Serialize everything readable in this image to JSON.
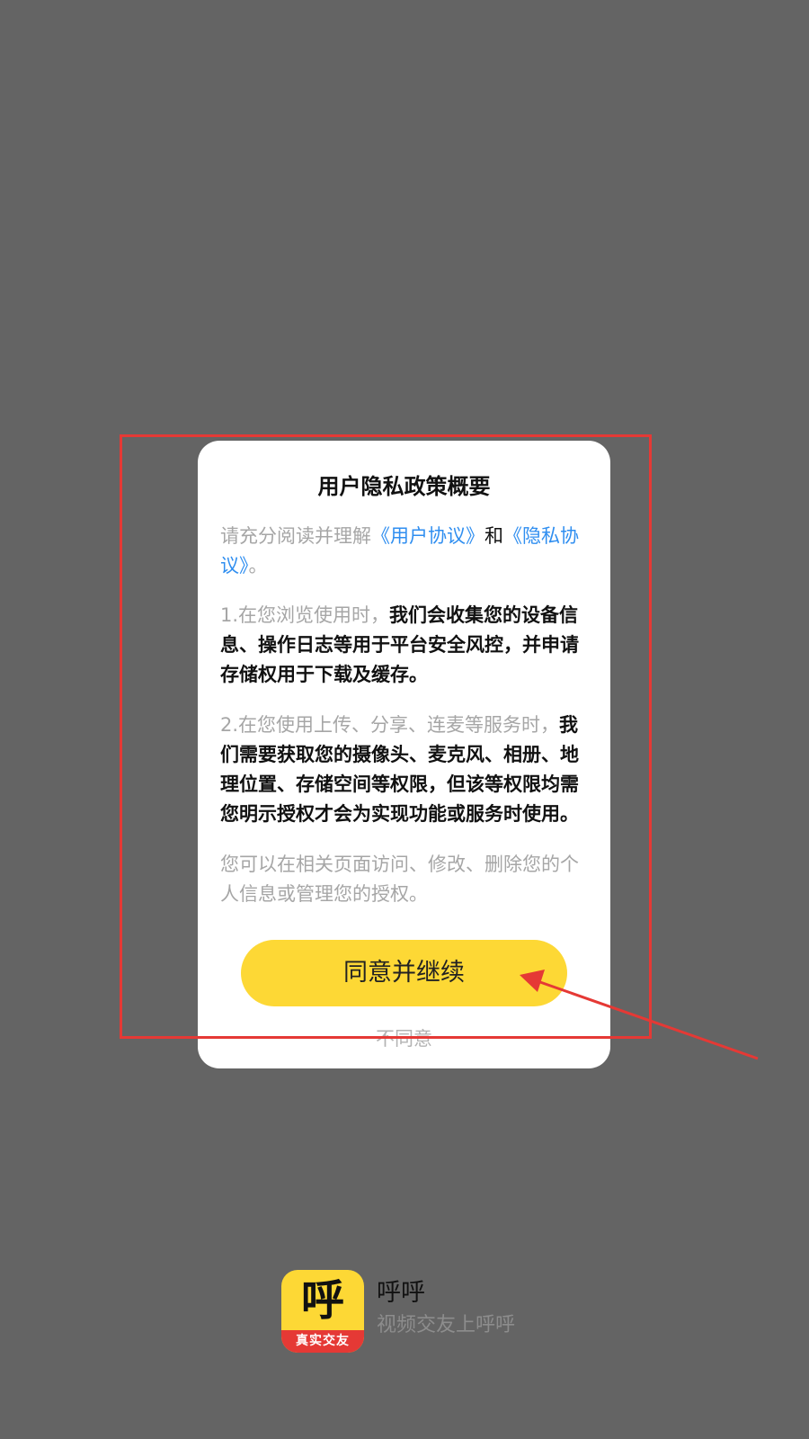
{
  "dialog": {
    "title": "用户隐私政策概要",
    "intro": {
      "prefix": "请充分阅读并理解",
      "user_agreement_link": "《用户协议》",
      "and": "和",
      "privacy_link": "《隐私协议》",
      "suffix": "。"
    },
    "clause1": {
      "prefix": "1.在您浏览使用时，",
      "strong": "我们会收集您的设备信息、操作日志等用于平台安全风控，并申请存储权用于下载及缓存。"
    },
    "clause2": {
      "prefix": "2.在您使用上传、分享、连麦等服务时，",
      "strong": "我们需要获取您的摄像头、麦克风、相册、地理位置、存储空间等权限，但该等权限均需您明示授权才会为实现功能或服务时使用。"
    },
    "note": "您可以在相关页面访问、修改、删除您的个人信息或管理您的授权。",
    "agree_label": "同意并继续",
    "disagree_label": "不同意"
  },
  "app": {
    "icon_glyph": "呼",
    "icon_band": "真实交友",
    "name": "呼呼",
    "slogan": "视频交友上呼呼"
  },
  "colors": {
    "overlay": "#646464",
    "accent_yellow": "#fdd835",
    "link_blue": "#2f8ef0",
    "annotation_red": "#e53935"
  }
}
